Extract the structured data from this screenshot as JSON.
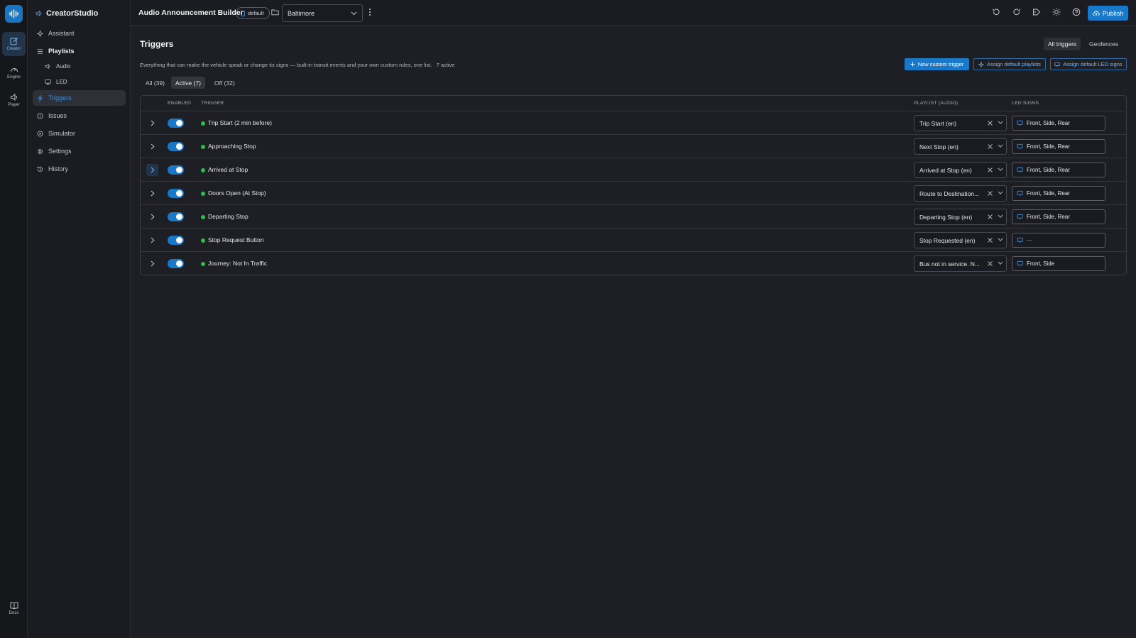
{
  "rail": {
    "items": [
      {
        "label": "Creator",
        "icon": "edit-icon"
      },
      {
        "label": "Engine",
        "icon": "gauge-icon"
      },
      {
        "label": "Player",
        "icon": "speaker-icon"
      }
    ],
    "docs": {
      "label": "Docs",
      "icon": "book-icon"
    }
  },
  "sidebar": {
    "brand": "CreatorStudio",
    "items": [
      {
        "label": "Assistant"
      },
      {
        "label": "Playlists"
      },
      {
        "label": "Audio"
      },
      {
        "label": "LED"
      },
      {
        "label": "Triggers"
      },
      {
        "label": "Issues"
      },
      {
        "label": "Simulator"
      },
      {
        "label": "Settings"
      },
      {
        "label": "History"
      }
    ]
  },
  "header": {
    "title": "Audio Announcement Builder",
    "badge": "default",
    "project": "Baltimore",
    "publish_label": "Publish"
  },
  "page": {
    "title": "Triggers",
    "view_tabs": [
      "All triggers",
      "Geofences"
    ],
    "description": "Everything that can make the vehicle speak or change its signs — built-in transit events and your own custom rules, one list.",
    "active_note": "7 active",
    "actions": {
      "new_trigger": "New custom trigger",
      "assign_playlists": "Assign default playlists",
      "assign_led": "Assign default LED signs"
    },
    "filters": [
      "All (39)",
      "Active (7)",
      "Off (32)"
    ]
  },
  "table": {
    "headers": {
      "enabled": "ENABLED",
      "trigger": "TRIGGER",
      "playlist": "PLAYLIST (AUDIO)",
      "led": "LED SIGNS"
    },
    "rows": [
      {
        "trigger": "Trip Start (2 min before)",
        "playlist": "Trip Start (en)",
        "led": "Front, Side, Rear"
      },
      {
        "trigger": "Approaching Stop",
        "playlist": "Next Stop (en)",
        "led": "Front, Side, Rear"
      },
      {
        "trigger": "Arrived at Stop",
        "playlist": "Arrived at Stop (en)",
        "led": "Front, Side, Rear"
      },
      {
        "trigger": "Doors Open (At Stop)",
        "playlist": "Route to Destination...",
        "led": "Front, Side, Rear"
      },
      {
        "trigger": "Departing Stop",
        "playlist": "Departing Stop (en)",
        "led": "Front, Side, Rear"
      },
      {
        "trigger": "Stop Request Button",
        "playlist": "Stop Requested (en)",
        "led": "—"
      },
      {
        "trigger": "Journey: Not In Traffic",
        "playlist": "Bus not in service. N...",
        "led": "Front, Side"
      }
    ]
  },
  "colors": {
    "accent": "#1a78c8",
    "active_dot": "#2ebd47",
    "background": "#1e1f24"
  }
}
